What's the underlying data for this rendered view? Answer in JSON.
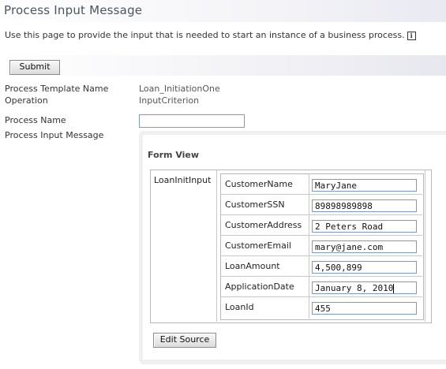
{
  "page": {
    "title": "Process Input Message",
    "description": "Use this page to provide the input that is needed to start an instance of a business process.",
    "info_icon_glyph": "i"
  },
  "toolbar": {
    "submit_label": "Submit"
  },
  "details": {
    "template_label": "Process Template Name",
    "template_value": "Loan_InitiationOne",
    "operation_label": "Operation",
    "operation_value": "InputCriterion",
    "process_name_label": "Process Name",
    "process_name_value": "",
    "input_message_label": "Process Input Message"
  },
  "form": {
    "view_title": "Form View",
    "root_label": "LoanInitInput",
    "fields": [
      {
        "label": "CustomerName",
        "value": "MaryJane"
      },
      {
        "label": "CustomerSSN",
        "value": "89898989898"
      },
      {
        "label": "CustomerAddress",
        "value": "2 Peters Road"
      },
      {
        "label": "CustomerEmail",
        "value": "mary@jane.com"
      },
      {
        "label": "LoanAmount",
        "value": "4,500,899"
      },
      {
        "label": "ApplicationDate",
        "value": "January 8, 2010"
      },
      {
        "label": "LoanId",
        "value": "455"
      }
    ],
    "edit_source_label": "Edit Source"
  }
}
